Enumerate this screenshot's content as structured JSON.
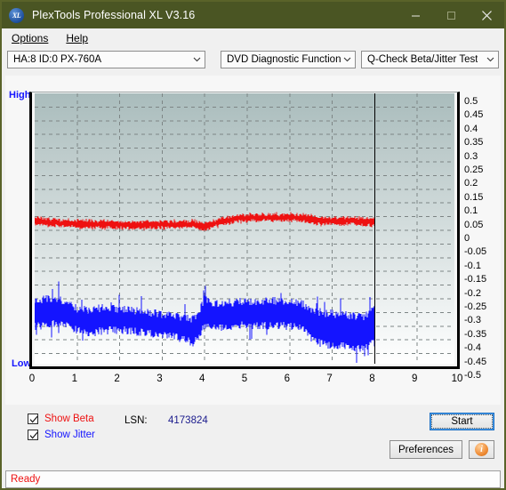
{
  "window": {
    "title": "PlexTools Professional XL V3.16",
    "icon": "app-xl-icon",
    "buttons": {
      "minimize": "minimize-icon",
      "maximize": "maximize-icon",
      "close": "close-icon"
    }
  },
  "menubar": {
    "items": [
      {
        "label": "Options",
        "accel": "O"
      },
      {
        "label": "Help",
        "accel": "H"
      }
    ]
  },
  "toolbar": {
    "drive_select": "HA:8 ID:0  PX-760A",
    "function_select": "DVD Diagnostic Functions",
    "test_select": "Q-Check Beta/Jitter Test",
    "arrow_icon": "chevron-down-icon"
  },
  "chart_data": {
    "type": "line",
    "title": "",
    "xlabel": "",
    "ylabel": "",
    "axis_left_labels": {
      "high": "High",
      "low": "Low"
    },
    "xlim": [
      0,
      10
    ],
    "ylim": [
      -0.5,
      0.5
    ],
    "xticks": [
      0,
      1,
      2,
      3,
      4,
      5,
      6,
      7,
      8,
      9,
      10
    ],
    "yticks": [
      "0.5",
      "0.45",
      "0.4",
      "0.35",
      "0.3",
      "0.25",
      "0.2",
      "0.15",
      "0.1",
      "0.05",
      "0",
      "-0.05",
      "-0.1",
      "-0.15",
      "-0.2",
      "-0.25",
      "-0.3",
      "-0.35",
      "-0.4",
      "-0.45",
      "-0.5"
    ],
    "grid": true,
    "grid_style": "dashed",
    "legend": [
      "Show Beta",
      "Show Jitter"
    ],
    "data_end_marker_x": 8,
    "series": [
      {
        "name": "Beta",
        "color": "#ee1111",
        "x": [
          0.0,
          0.25,
          0.5,
          0.75,
          1.0,
          1.25,
          1.5,
          1.75,
          2.0,
          2.25,
          2.5,
          2.75,
          3.0,
          3.25,
          3.5,
          3.75,
          4.0,
          4.25,
          4.5,
          4.75,
          5.0,
          5.25,
          5.5,
          5.75,
          6.0,
          6.25,
          6.5,
          6.75,
          7.0,
          7.25,
          7.5,
          7.75,
          8.0
        ],
        "values": [
          0.035,
          0.031,
          0.028,
          0.026,
          0.024,
          0.023,
          0.022,
          0.021,
          0.02,
          0.019,
          0.018,
          0.02,
          0.021,
          0.022,
          0.023,
          0.023,
          0.014,
          0.026,
          0.036,
          0.042,
          0.045,
          0.046,
          0.047,
          0.046,
          0.047,
          0.046,
          0.04,
          0.034,
          0.033,
          0.034,
          0.035,
          0.03,
          0.032
        ]
      },
      {
        "name": "Jitter",
        "color": "#1414ff",
        "x": [
          0.0,
          0.25,
          0.5,
          0.75,
          1.0,
          1.25,
          1.5,
          1.75,
          2.0,
          2.25,
          2.5,
          2.75,
          3.0,
          3.25,
          3.5,
          3.75,
          4.0,
          4.25,
          4.5,
          4.75,
          5.0,
          5.25,
          5.5,
          5.75,
          6.0,
          6.25,
          6.5,
          6.75,
          7.0,
          7.25,
          7.5,
          7.75,
          8.0
        ],
        "upper": [
          -0.255,
          -0.25,
          -0.252,
          -0.262,
          -0.286,
          -0.292,
          -0.284,
          -0.285,
          -0.288,
          -0.292,
          -0.296,
          -0.3,
          -0.306,
          -0.312,
          -0.318,
          -0.326,
          -0.252,
          -0.268,
          -0.266,
          -0.262,
          -0.258,
          -0.258,
          -0.256,
          -0.258,
          -0.258,
          -0.262,
          -0.286,
          -0.3,
          -0.304,
          -0.308,
          -0.312,
          -0.316,
          -0.278
        ],
        "lower": [
          -0.352,
          -0.346,
          -0.34,
          -0.348,
          -0.366,
          -0.372,
          -0.368,
          -0.366,
          -0.364,
          -0.368,
          -0.372,
          -0.376,
          -0.382,
          -0.388,
          -0.398,
          -0.412,
          -0.35,
          -0.356,
          -0.352,
          -0.348,
          -0.346,
          -0.348,
          -0.346,
          -0.348,
          -0.35,
          -0.356,
          -0.392,
          -0.414,
          -0.42,
          -0.424,
          -0.428,
          -0.434,
          -0.408
        ]
      }
    ]
  },
  "controls": {
    "show_beta": {
      "label": "Show Beta",
      "accel": "B",
      "checked": true
    },
    "show_jitter": {
      "label": "Show Jitter",
      "accel": "J",
      "checked": true
    },
    "lsn_label": "LSN:",
    "lsn_value": "4173824",
    "start_button": "Start",
    "start_accel": "S",
    "preferences_button": "Preferences",
    "preferences_accel": "P",
    "info_button": "info-icon",
    "check_icon": "checkmark-icon"
  },
  "statusbar": {
    "text": "Ready"
  }
}
